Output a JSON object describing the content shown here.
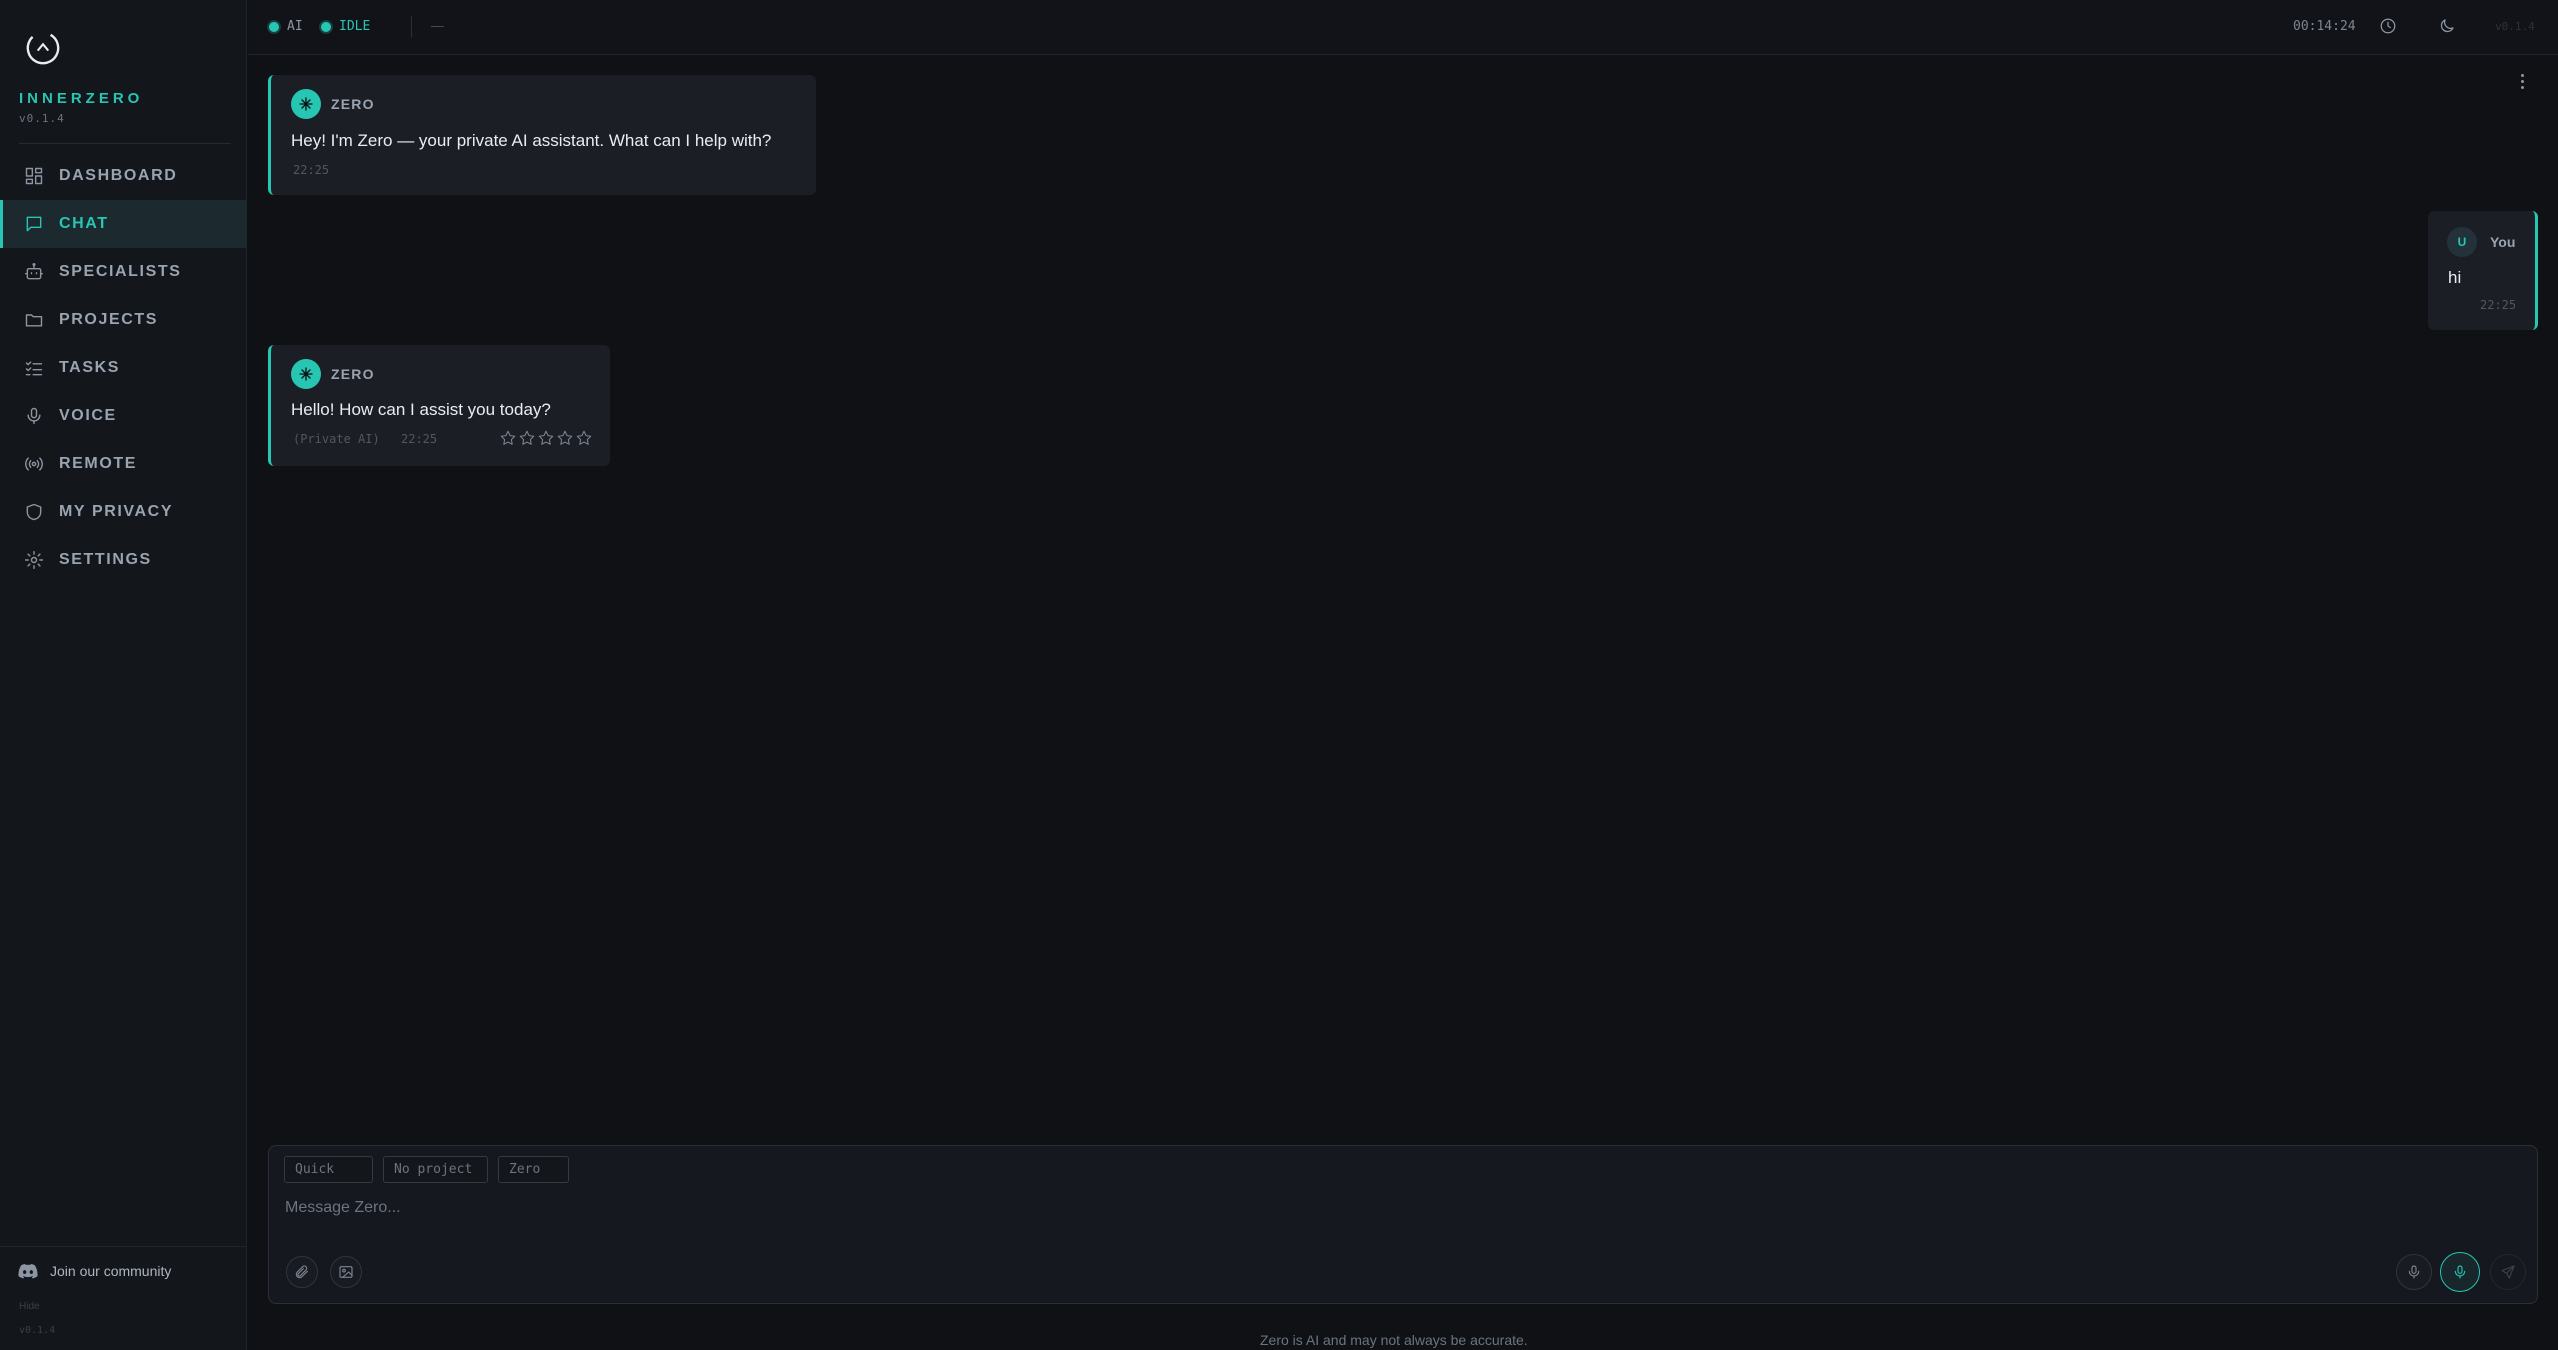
{
  "sidebar": {
    "brand": "INNERZERO",
    "version": "v0.1.4",
    "items": [
      {
        "label": "DASHBOARD",
        "icon": "dashboard-icon"
      },
      {
        "label": "CHAT",
        "icon": "chat-icon",
        "active": true
      },
      {
        "label": "SPECIALISTS",
        "icon": "robot-icon"
      },
      {
        "label": "PROJECTS",
        "icon": "folder-icon"
      },
      {
        "label": "TASKS",
        "icon": "checklist-icon"
      },
      {
        "label": "VOICE",
        "icon": "microphone-icon"
      },
      {
        "label": "REMOTE",
        "icon": "broadcast-icon"
      },
      {
        "label": "MY PRIVACY",
        "icon": "shield-icon"
      },
      {
        "label": "SETTINGS",
        "icon": "gear-icon"
      }
    ],
    "community": "Join our community",
    "hide": "Hide",
    "footer_version": "v0.1.4"
  },
  "topbar": {
    "ai_label": "AI",
    "status_label": "IDLE",
    "dash": "—",
    "clock": "00:14:24",
    "version": "v0.1.4"
  },
  "messages": [
    {
      "sender": "ZERO",
      "text": "Hey! I'm Zero — your private AI assistant. What can I help with?",
      "time": "22:25"
    },
    {
      "sender": "You",
      "avatar": "U",
      "text": "hi",
      "time": "22:25"
    },
    {
      "sender": "ZERO",
      "text": "Hello! How can I assist you today?",
      "tag": "(Private AI)",
      "time": "22:25",
      "rating_max": 5
    }
  ],
  "composer": {
    "chip_mode": "Quick",
    "chip_project": "No project",
    "chip_agent": "Zero",
    "placeholder": "Message Zero..."
  },
  "footer_note": "Zero is AI and may not always be accurate.",
  "colors": {
    "accent": "#27c6b2",
    "background": "#0f1115",
    "sidebar": "#13161b"
  }
}
